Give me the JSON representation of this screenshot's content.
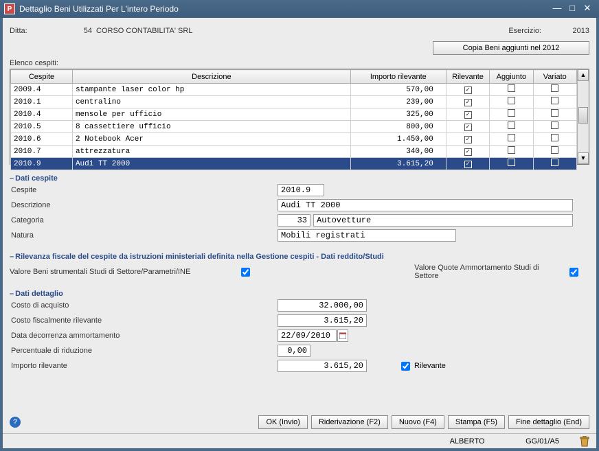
{
  "window": {
    "title": "Dettaglio Beni Utilizzati Per L'intero Periodo",
    "app_icon_letter": "P"
  },
  "header": {
    "ditta_label": "Ditta:",
    "ditta_num": "54",
    "ditta_name": "CORSO CONTABILITA' SRL",
    "esercizio_label": "Esercizio:",
    "esercizio_val": "2013",
    "copy_btn": "Copia Beni aggiunti nel 2012"
  },
  "elenco_label": "Elenco cespiti:",
  "grid": {
    "cols": {
      "cespite": "Cespite",
      "descrizione": "Descrizione",
      "importo": "Importo rilevante",
      "rilevante": "Rilevante",
      "aggiunto": "Aggiunto",
      "variato": "Variato"
    },
    "rows": [
      {
        "c": "2009.4",
        "d": "stampante laser color hp",
        "i": "570,00",
        "r": true,
        "a": false,
        "v": false,
        "sel": false
      },
      {
        "c": "2010.1",
        "d": "centralino",
        "i": "239,00",
        "r": true,
        "a": false,
        "v": false,
        "sel": false
      },
      {
        "c": "2010.4",
        "d": "mensole per ufficio",
        "i": "325,00",
        "r": true,
        "a": false,
        "v": false,
        "sel": false
      },
      {
        "c": "2010.5",
        "d": "8 cassettiere ufficio",
        "i": "800,00",
        "r": true,
        "a": false,
        "v": false,
        "sel": false
      },
      {
        "c": "2010.6",
        "d": "2 Notebook Acer",
        "i": "1.450,00",
        "r": true,
        "a": false,
        "v": false,
        "sel": false
      },
      {
        "c": "2010.7",
        "d": "attrezzatura",
        "i": "340,00",
        "r": true,
        "a": false,
        "v": false,
        "sel": false
      },
      {
        "c": "2010.9",
        "d": "Audi TT 2000",
        "i": "3.615,20",
        "r": true,
        "a": false,
        "v": false,
        "sel": true
      }
    ]
  },
  "sections": {
    "dati_cespite": "Dati cespite",
    "rilevanza": "Rilevanza fiscale del cespite da istruzioni ministeriali definita nella Gestione cespiti - Dati reddito/Studi",
    "dati_dettaglio": "Dati dettaglio"
  },
  "form": {
    "cespite_lbl": "Cespite",
    "cespite_val": "2010.9",
    "descr_lbl": "Descrizione",
    "descr_val": "Audi TT 2000",
    "categ_lbl": "Categoria",
    "categ_num": "33",
    "categ_val": "Autovetture",
    "natura_lbl": "Natura",
    "natura_val": "Mobili registrati",
    "val_beni_lbl": "Valore Beni strumentali Studi di Settore/Parametri/INE",
    "val_quote_lbl": "Valore Quote Ammortamento Studi di Settore",
    "costo_acq_lbl": "Costo di acquisto",
    "costo_acq_val": "32.000,00",
    "costo_fisc_lbl": "Costo fiscalmente rilevante",
    "costo_fisc_val": "3.615,20",
    "data_dec_lbl": "Data decorrenza ammortamento",
    "data_dec_val": "22/09/2010",
    "perc_rid_lbl": "Percentuale di riduzione",
    "perc_rid_val": "0,00",
    "imp_ril_lbl": "Importo rilevante",
    "imp_ril_val": "3.615,20",
    "rilevante_chk_lbl": "Rilevante"
  },
  "buttons": {
    "ok": "OK (Invio)",
    "rideriv": "Riderivazione (F2)",
    "nuovo": "Nuovo (F4)",
    "stampa": "Stampa (F5)",
    "fine": "Fine dettaglio (End)"
  },
  "status": {
    "user": "ALBERTO",
    "loc": "GG/01/A5"
  }
}
